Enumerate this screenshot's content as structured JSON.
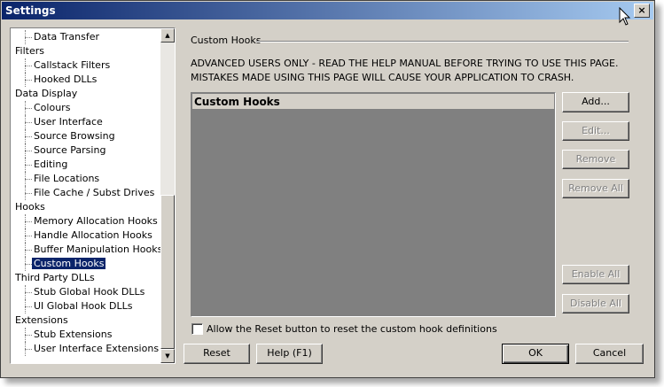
{
  "window": {
    "title": "Settings",
    "close_glyph": "×"
  },
  "tree": {
    "items": [
      {
        "label": "Data Transfer",
        "level": 1
      },
      {
        "label": "Filters",
        "level": 0
      },
      {
        "label": "Callstack Filters",
        "level": 1
      },
      {
        "label": "Hooked DLLs",
        "level": 1
      },
      {
        "label": "Data Display",
        "level": 0
      },
      {
        "label": "Colours",
        "level": 1
      },
      {
        "label": "User Interface",
        "level": 1
      },
      {
        "label": "Source Browsing",
        "level": 1
      },
      {
        "label": "Source Parsing",
        "level": 1
      },
      {
        "label": "Editing",
        "level": 1
      },
      {
        "label": "File Locations",
        "level": 1
      },
      {
        "label": "File Cache / Subst Drives",
        "level": 1
      },
      {
        "label": "Hooks",
        "level": 0
      },
      {
        "label": "Memory Allocation Hooks",
        "level": 1
      },
      {
        "label": "Handle Allocation Hooks",
        "level": 1
      },
      {
        "label": "Buffer Manipulation Hooks",
        "level": 1
      },
      {
        "label": "Custom Hooks",
        "level": 1,
        "selected": true
      },
      {
        "label": "Third Party DLLs",
        "level": 0
      },
      {
        "label": "Stub Global Hook DLLs",
        "level": 1
      },
      {
        "label": "UI Global Hook DLLs",
        "level": 1
      },
      {
        "label": "Extensions",
        "level": 0
      },
      {
        "label": "Stub Extensions",
        "level": 1
      },
      {
        "label": "User Interface Extensions",
        "level": 1
      }
    ],
    "scroll_up_glyph": "▲",
    "scroll_down_glyph": "▼"
  },
  "panel": {
    "group_title": "Custom Hooks",
    "warning_line1": "ADVANCED USERS ONLY - READ THE HELP MANUAL BEFORE TRYING TO USE THIS PAGE.",
    "warning_line2": "MISTAKES MADE USING THIS PAGE WILL CAUSE YOUR APPLICATION TO CRASH.",
    "list_header": "Custom Hooks",
    "buttons": {
      "add": "Add...",
      "edit": "Edit...",
      "remove": "Remove",
      "remove_all": "Remove All",
      "enable_all": "Enable All",
      "disable_all": "Disable All"
    },
    "checkbox_label": "Allow the Reset button to reset the custom hook definitions",
    "checkbox_checked": false
  },
  "footer": {
    "reset": "Reset",
    "help": "Help (F1)",
    "ok": "OK",
    "cancel": "Cancel"
  },
  "colors": {
    "title_start": "#0a246a",
    "title_end": "#a6caf0",
    "face": "#d4d0c8",
    "selection": "#0a246a",
    "list_bg": "#808080"
  }
}
